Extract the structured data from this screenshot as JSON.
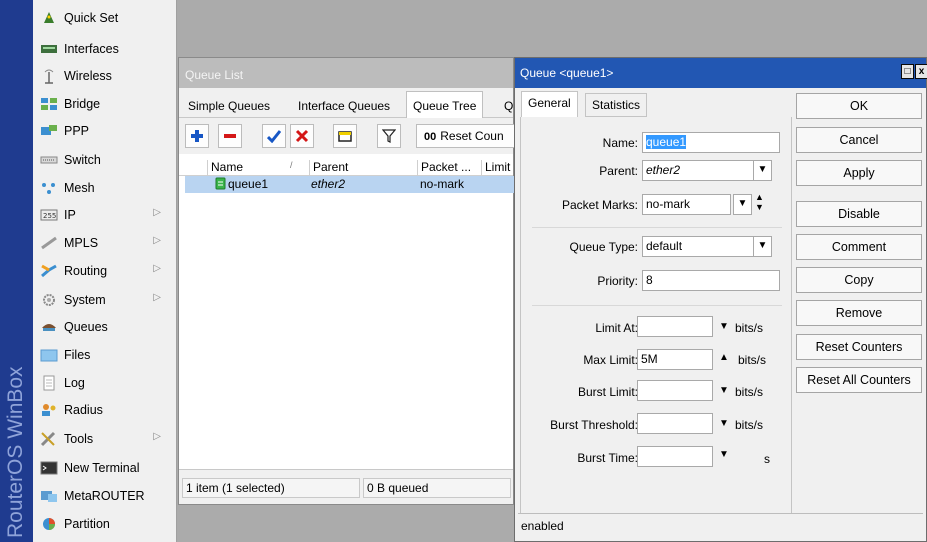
{
  "brand": {
    "text": "RouterOS WinBox"
  },
  "menu": {
    "items": [
      {
        "label": "Quick Set",
        "icon": "wizard-hat-icon",
        "submenu": false
      },
      {
        "label": "Interfaces",
        "icon": "network-card-icon",
        "submenu": false
      },
      {
        "label": "Wireless",
        "icon": "antenna-icon",
        "submenu": false
      },
      {
        "label": "Bridge",
        "icon": "bridge-icon",
        "submenu": false
      },
      {
        "label": "PPP",
        "icon": "ppp-icon",
        "submenu": false
      },
      {
        "label": "Switch",
        "icon": "switch-icon",
        "submenu": false
      },
      {
        "label": "Mesh",
        "icon": "mesh-icon",
        "submenu": false
      },
      {
        "label": "IP",
        "icon": "ip-icon",
        "submenu": true
      },
      {
        "label": "MPLS",
        "icon": "mpls-icon",
        "submenu": true
      },
      {
        "label": "Routing",
        "icon": "routing-icon",
        "submenu": true
      },
      {
        "label": "System",
        "icon": "system-gear-icon",
        "submenu": true
      },
      {
        "label": "Queues",
        "icon": "queues-icon",
        "submenu": false
      },
      {
        "label": "Files",
        "icon": "folder-icon",
        "submenu": false
      },
      {
        "label": "Log",
        "icon": "log-icon",
        "submenu": false
      },
      {
        "label": "Radius",
        "icon": "radius-users-icon",
        "submenu": false
      },
      {
        "label": "Tools",
        "icon": "tools-icon",
        "submenu": true
      },
      {
        "label": "New Terminal",
        "icon": "terminal-icon",
        "submenu": false
      },
      {
        "label": "MetaROUTER",
        "icon": "metarouter-icon",
        "submenu": false
      },
      {
        "label": "Partition",
        "icon": "partition-pie-icon",
        "submenu": false
      }
    ]
  },
  "queue_list": {
    "title": "Queue List",
    "tabs": [
      "Simple Queues",
      "Interface Queues",
      "Queue Tree",
      "Q"
    ],
    "active_tab": "Queue Tree",
    "toolbar": {
      "reset_label": "Reset Coun",
      "reset_prefix": "00"
    },
    "columns": [
      "Name",
      "Parent",
      "Packet ...",
      "Limit"
    ],
    "sort_marker": "/",
    "rows": [
      {
        "name": "queue1",
        "parent": "ether2",
        "packet_marks": "no-mark",
        "limit": ""
      }
    ],
    "status": {
      "count": "1 item (1 selected)",
      "queued": "0 B queued"
    }
  },
  "queue_dialog": {
    "title": "Queue <queue1>",
    "tabs": [
      "General",
      "Statistics"
    ],
    "active_tab": "General",
    "fields": {
      "name": {
        "label": "Name:",
        "value": "queue1"
      },
      "parent": {
        "label": "Parent:",
        "value": "ether2"
      },
      "packet_marks": {
        "label": "Packet Marks:",
        "value": "no-mark"
      },
      "queue_type": {
        "label": "Queue Type:",
        "value": "default"
      },
      "priority": {
        "label": "Priority:",
        "value": "8"
      },
      "limit_at": {
        "label": "Limit At:",
        "value": "",
        "unit": "bits/s"
      },
      "max_limit": {
        "label": "Max Limit:",
        "value": "5M",
        "unit": "bits/s"
      },
      "burst_limit": {
        "label": "Burst Limit:",
        "value": "",
        "unit": "bits/s"
      },
      "burst_threshold": {
        "label": "Burst Threshold:",
        "value": "",
        "unit": "bits/s"
      },
      "burst_time": {
        "label": "Burst Time:",
        "value": "",
        "unit": "s"
      }
    },
    "buttons": {
      "ok": "OK",
      "cancel": "Cancel",
      "apply": "Apply",
      "disable": "Disable",
      "comment": "Comment",
      "copy": "Copy",
      "remove": "Remove",
      "reset_counters": "Reset Counters",
      "reset_all_counters": "Reset All Counters"
    },
    "status": "enabled"
  },
  "colors": {
    "title_active": "#2257b3",
    "selection": "#b9d4f1",
    "brand_strip": "#1f3b8f"
  }
}
